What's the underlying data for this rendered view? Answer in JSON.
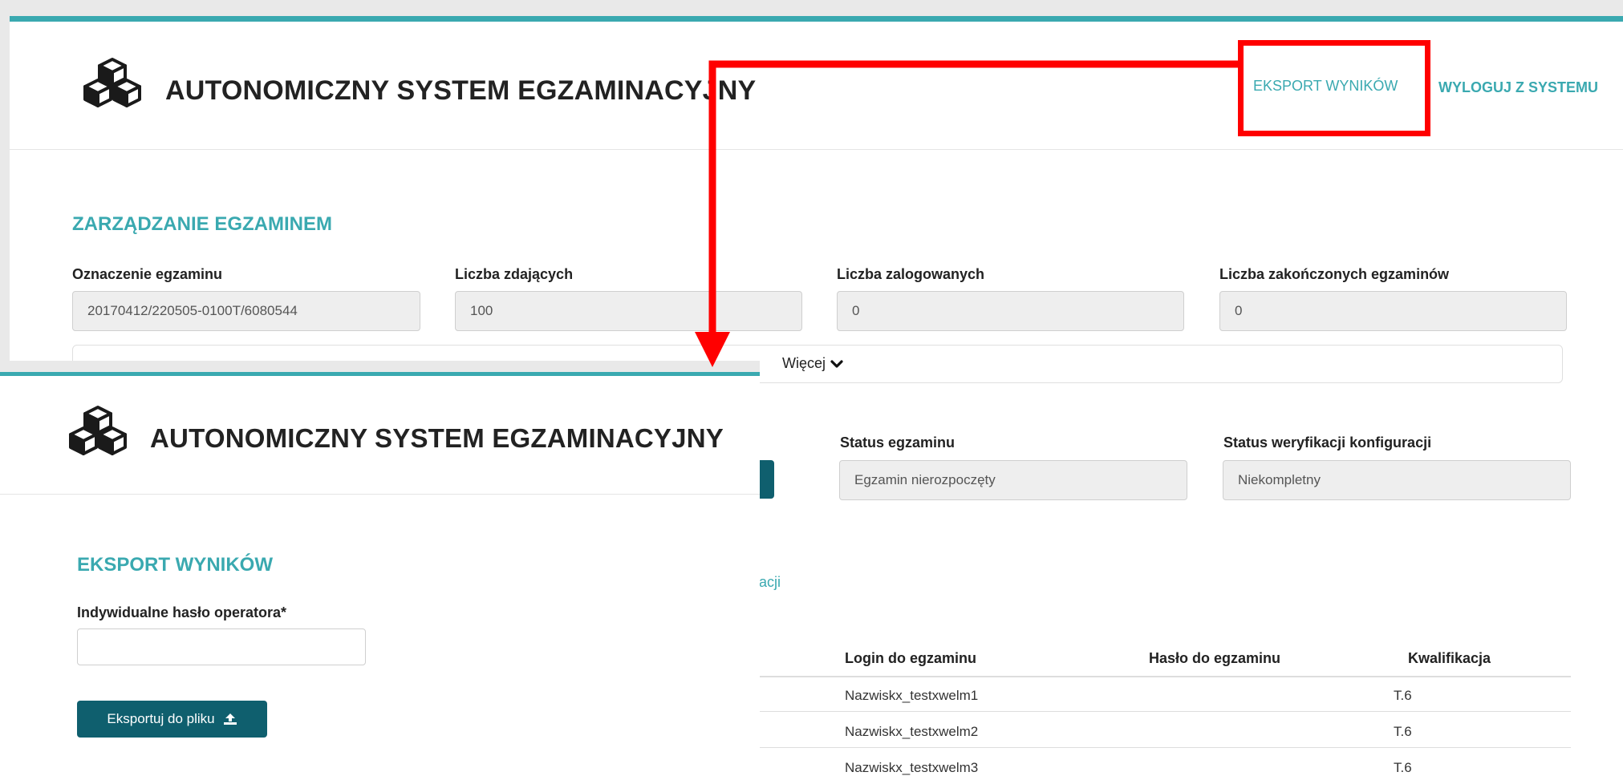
{
  "app": {
    "title": "AUTONOMICZNY SYSTEM EGZAMINACYJNY"
  },
  "header": {
    "export_link": "EKSPORT WYNIKÓW",
    "logout_link": "WYLOGUJ Z SYSTEMU"
  },
  "exam_management": {
    "title": "ZARZĄDZANIE EGZAMINEM",
    "fields": [
      {
        "label": "Oznaczenie egzaminu",
        "value": "20170412/220505-0100T/6080544"
      },
      {
        "label": "Liczba zdających",
        "value": "100"
      },
      {
        "label": "Liczba zalogowanych",
        "value": "0"
      },
      {
        "label": "Liczba zakończonych egzaminów",
        "value": "0"
      }
    ],
    "more_label": "Więcej",
    "status": {
      "exam_label": "Status egzaminu",
      "exam_value": "Egzamin nierozpoczęty",
      "config_label": "Status weryfikacji konfiguracji",
      "config_value": "Niekompletny"
    },
    "link_fragment": "acji",
    "table": {
      "headers": [
        "Login do egzaminu",
        "Hasło do egzaminu",
        "Kwalifikacja"
      ],
      "rows": [
        {
          "login": "Nazwiskx_testxwelm1",
          "password": "",
          "qualification": "T.6"
        },
        {
          "login": "Nazwiskx_testxwelm2",
          "password": "",
          "qualification": "T.6"
        },
        {
          "login": "Nazwiskx_testxwelm3",
          "password": "",
          "qualification": "T.6"
        }
      ]
    }
  },
  "export_screen": {
    "title": "EKSPORT WYNIKÓW",
    "password_label": "Indywidualne hasło operatora*",
    "password_value": "",
    "export_button": "Eksportuj do pliku"
  },
  "icons": {
    "logo": "cubes-logo-icon",
    "chevron": "chevron-down-icon",
    "upload": "upload-icon"
  },
  "colors": {
    "accent": "#3aa9b0",
    "button": "#0f5f6e",
    "annotation": "#ff0000"
  }
}
